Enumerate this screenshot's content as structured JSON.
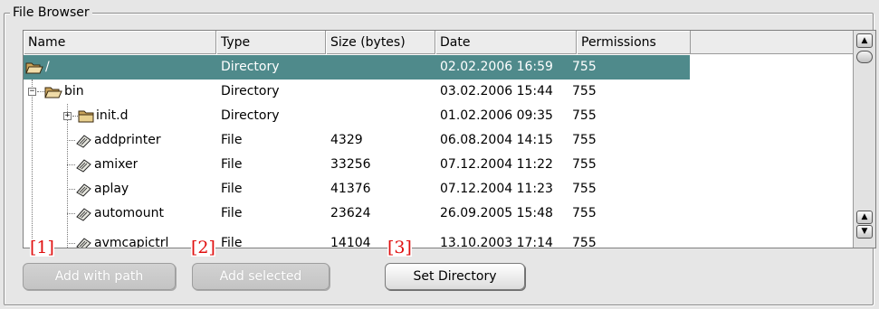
{
  "group": {
    "title": "File Browser"
  },
  "columns": [
    "Name",
    "Type",
    "Size (bytes)",
    "Date",
    "Permissions"
  ],
  "rows": [
    {
      "name": "/",
      "type": "Directory",
      "size": "",
      "date": "02.02.2006 16:59",
      "perm": "755",
      "icon": "folder-open-icon"
    },
    {
      "name": "bin",
      "type": "Directory",
      "size": "",
      "date": "03.02.2006 15:44",
      "perm": "755",
      "icon": "folder-open-icon"
    },
    {
      "name": "init.d",
      "type": "Directory",
      "size": "",
      "date": "01.02.2006 09:35",
      "perm": "755",
      "icon": "folder-icon"
    },
    {
      "name": "addprinter",
      "type": "File",
      "size": "4329",
      "date": "06.08.2004 14:15",
      "perm": "755",
      "icon": "executable-file-icon"
    },
    {
      "name": "amixer",
      "type": "File",
      "size": "33256",
      "date": "07.12.2004 11:22",
      "perm": "755",
      "icon": "executable-file-icon"
    },
    {
      "name": "aplay",
      "type": "File",
      "size": "41376",
      "date": "07.12.2004 11:23",
      "perm": "755",
      "icon": "executable-file-icon"
    },
    {
      "name": "automount",
      "type": "File",
      "size": "23624",
      "date": "26.09.2005 15:48",
      "perm": "755",
      "icon": "executable-file-icon"
    },
    {
      "name": "avmcapictrl",
      "type": "File",
      "size": "14104",
      "date": "13.10.2003 17:14",
      "perm": "755",
      "icon": "executable-file-icon"
    }
  ],
  "buttons": {
    "add_with_path": "Add with path",
    "add_selected": "Add selected",
    "set_directory": "Set Directory"
  },
  "markers": [
    "[1]",
    "[2]",
    "[3]"
  ],
  "colors": {
    "selection": "#4f8a8b",
    "marker": "#e01010"
  }
}
